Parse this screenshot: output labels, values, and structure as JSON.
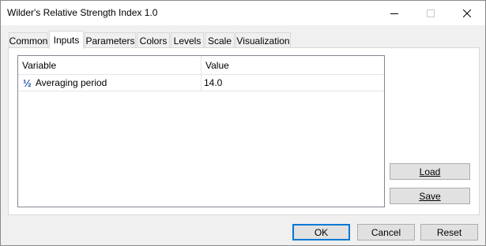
{
  "window": {
    "title": "Wilder's Relative Strength Index 1.0"
  },
  "tabs": [
    {
      "label": "Common"
    },
    {
      "label": "Inputs"
    },
    {
      "label": "Parameters"
    },
    {
      "label": "Colors"
    },
    {
      "label": "Levels"
    },
    {
      "label": "Scale"
    },
    {
      "label": "Visualization"
    }
  ],
  "active_tab": "Inputs",
  "grid": {
    "columns": [
      "Variable",
      "Value"
    ],
    "rows": [
      {
        "icon": "½",
        "variable": "Averaging period",
        "value": "14.0"
      }
    ]
  },
  "side_buttons": {
    "load_label": "Load",
    "save_label": "Save"
  },
  "footer": {
    "ok_label": "OK",
    "cancel_label": "Cancel",
    "reset_label": "Reset"
  }
}
